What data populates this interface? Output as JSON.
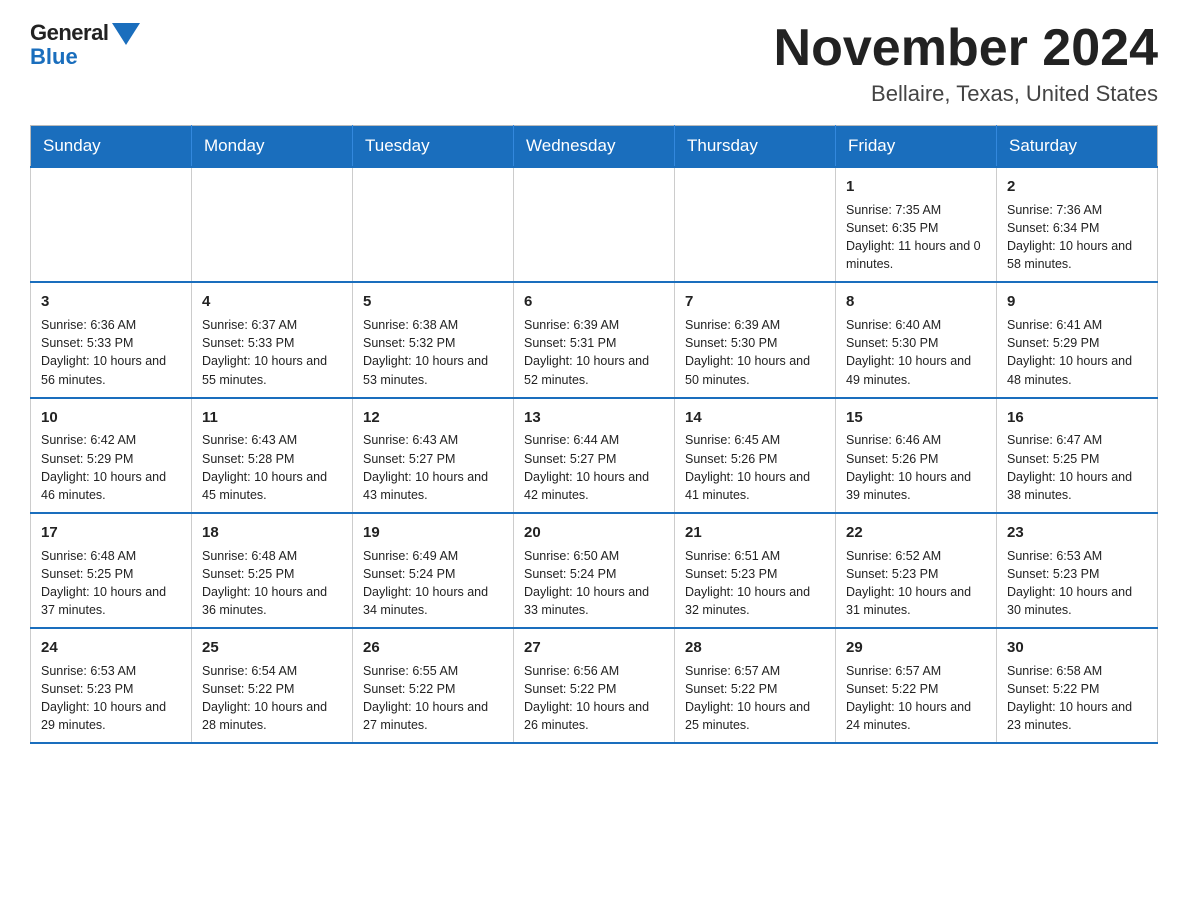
{
  "logo": {
    "general": "General",
    "blue": "Blue"
  },
  "title": "November 2024",
  "subtitle": "Bellaire, Texas, United States",
  "days_of_week": [
    "Sunday",
    "Monday",
    "Tuesday",
    "Wednesday",
    "Thursday",
    "Friday",
    "Saturday"
  ],
  "weeks": [
    [
      {
        "day": "",
        "info": ""
      },
      {
        "day": "",
        "info": ""
      },
      {
        "day": "",
        "info": ""
      },
      {
        "day": "",
        "info": ""
      },
      {
        "day": "",
        "info": ""
      },
      {
        "day": "1",
        "info": "Sunrise: 7:35 AM\nSunset: 6:35 PM\nDaylight: 11 hours and 0 minutes."
      },
      {
        "day": "2",
        "info": "Sunrise: 7:36 AM\nSunset: 6:34 PM\nDaylight: 10 hours and 58 minutes."
      }
    ],
    [
      {
        "day": "3",
        "info": "Sunrise: 6:36 AM\nSunset: 5:33 PM\nDaylight: 10 hours and 56 minutes."
      },
      {
        "day": "4",
        "info": "Sunrise: 6:37 AM\nSunset: 5:33 PM\nDaylight: 10 hours and 55 minutes."
      },
      {
        "day": "5",
        "info": "Sunrise: 6:38 AM\nSunset: 5:32 PM\nDaylight: 10 hours and 53 minutes."
      },
      {
        "day": "6",
        "info": "Sunrise: 6:39 AM\nSunset: 5:31 PM\nDaylight: 10 hours and 52 minutes."
      },
      {
        "day": "7",
        "info": "Sunrise: 6:39 AM\nSunset: 5:30 PM\nDaylight: 10 hours and 50 minutes."
      },
      {
        "day": "8",
        "info": "Sunrise: 6:40 AM\nSunset: 5:30 PM\nDaylight: 10 hours and 49 minutes."
      },
      {
        "day": "9",
        "info": "Sunrise: 6:41 AM\nSunset: 5:29 PM\nDaylight: 10 hours and 48 minutes."
      }
    ],
    [
      {
        "day": "10",
        "info": "Sunrise: 6:42 AM\nSunset: 5:29 PM\nDaylight: 10 hours and 46 minutes."
      },
      {
        "day": "11",
        "info": "Sunrise: 6:43 AM\nSunset: 5:28 PM\nDaylight: 10 hours and 45 minutes."
      },
      {
        "day": "12",
        "info": "Sunrise: 6:43 AM\nSunset: 5:27 PM\nDaylight: 10 hours and 43 minutes."
      },
      {
        "day": "13",
        "info": "Sunrise: 6:44 AM\nSunset: 5:27 PM\nDaylight: 10 hours and 42 minutes."
      },
      {
        "day": "14",
        "info": "Sunrise: 6:45 AM\nSunset: 5:26 PM\nDaylight: 10 hours and 41 minutes."
      },
      {
        "day": "15",
        "info": "Sunrise: 6:46 AM\nSunset: 5:26 PM\nDaylight: 10 hours and 39 minutes."
      },
      {
        "day": "16",
        "info": "Sunrise: 6:47 AM\nSunset: 5:25 PM\nDaylight: 10 hours and 38 minutes."
      }
    ],
    [
      {
        "day": "17",
        "info": "Sunrise: 6:48 AM\nSunset: 5:25 PM\nDaylight: 10 hours and 37 minutes."
      },
      {
        "day": "18",
        "info": "Sunrise: 6:48 AM\nSunset: 5:25 PM\nDaylight: 10 hours and 36 minutes."
      },
      {
        "day": "19",
        "info": "Sunrise: 6:49 AM\nSunset: 5:24 PM\nDaylight: 10 hours and 34 minutes."
      },
      {
        "day": "20",
        "info": "Sunrise: 6:50 AM\nSunset: 5:24 PM\nDaylight: 10 hours and 33 minutes."
      },
      {
        "day": "21",
        "info": "Sunrise: 6:51 AM\nSunset: 5:23 PM\nDaylight: 10 hours and 32 minutes."
      },
      {
        "day": "22",
        "info": "Sunrise: 6:52 AM\nSunset: 5:23 PM\nDaylight: 10 hours and 31 minutes."
      },
      {
        "day": "23",
        "info": "Sunrise: 6:53 AM\nSunset: 5:23 PM\nDaylight: 10 hours and 30 minutes."
      }
    ],
    [
      {
        "day": "24",
        "info": "Sunrise: 6:53 AM\nSunset: 5:23 PM\nDaylight: 10 hours and 29 minutes."
      },
      {
        "day": "25",
        "info": "Sunrise: 6:54 AM\nSunset: 5:22 PM\nDaylight: 10 hours and 28 minutes."
      },
      {
        "day": "26",
        "info": "Sunrise: 6:55 AM\nSunset: 5:22 PM\nDaylight: 10 hours and 27 minutes."
      },
      {
        "day": "27",
        "info": "Sunrise: 6:56 AM\nSunset: 5:22 PM\nDaylight: 10 hours and 26 minutes."
      },
      {
        "day": "28",
        "info": "Sunrise: 6:57 AM\nSunset: 5:22 PM\nDaylight: 10 hours and 25 minutes."
      },
      {
        "day": "29",
        "info": "Sunrise: 6:57 AM\nSunset: 5:22 PM\nDaylight: 10 hours and 24 minutes."
      },
      {
        "day": "30",
        "info": "Sunrise: 6:58 AM\nSunset: 5:22 PM\nDaylight: 10 hours and 23 minutes."
      }
    ]
  ],
  "colors": {
    "header_bg": "#1a6ebd",
    "header_text": "#ffffff",
    "border": "#cccccc",
    "accent_border": "#1a6ebd"
  }
}
